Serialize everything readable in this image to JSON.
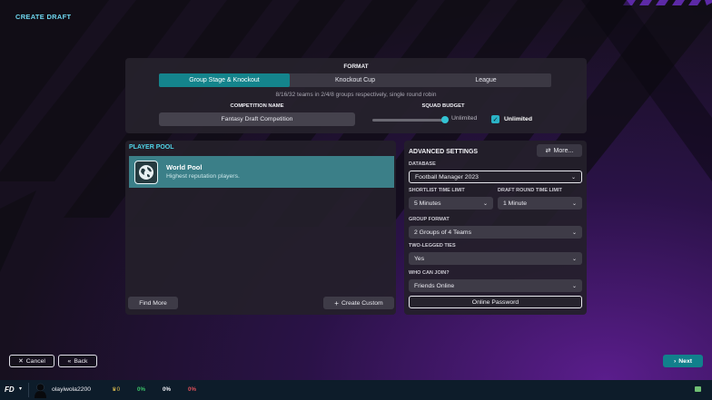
{
  "screen": {
    "title": "CREATE DRAFT"
  },
  "format": {
    "label": "FORMAT",
    "options": [
      "Group Stage & Knockout",
      "Knockout Cup",
      "League"
    ],
    "selected": "Group Stage & Knockout",
    "description": "8/16/32 teams in 2/4/8 groups respectively, single round robin"
  },
  "competition": {
    "label": "COMPETITION NAME",
    "value": "Fantasy Draft Competition"
  },
  "squad_budget": {
    "label": "SQUAD BUDGET",
    "slider_value": "Unlimited",
    "checkbox_label": "Unlimited",
    "checked": true,
    "level_fraction": 1.0
  },
  "player_pool": {
    "title": "PLAYER POOL",
    "items": [
      {
        "name": "World Pool",
        "description": "Highest reputation players."
      }
    ],
    "find_more": "Find More",
    "create_custom": "Create Custom"
  },
  "advanced": {
    "title": "ADVANCED SETTINGS",
    "more_button": "More...",
    "database": {
      "label": "DATABASE",
      "value": "Football Manager 2023"
    },
    "shortlist_time": {
      "label": "SHORTLIST TIME LIMIT",
      "value": "5 Minutes"
    },
    "draft_round_time": {
      "label": "DRAFT ROUND TIME LIMIT",
      "value": "1 Minute"
    },
    "group_format": {
      "label": "GROUP FORMAT",
      "value": "2 Groups of 4 Teams"
    },
    "two_legged": {
      "label": "TWO-LEGGED TIES",
      "value": "Yes"
    },
    "who_can_join": {
      "label": "WHO CAN JOIN?",
      "value": "Friends Online"
    },
    "password_button": "Online Password"
  },
  "footer": {
    "cancel": "Cancel",
    "back": "Back",
    "next": "Next"
  },
  "statusbar": {
    "logo": "FD",
    "username": "olayiwola2200",
    "trophies": "0",
    "stat1": "0%",
    "stat2": "0%",
    "stat3": "0%",
    "colors": {
      "stat1": "#3cc46a",
      "stat2": "#f0f0f5",
      "stat3": "#e0505a"
    }
  }
}
